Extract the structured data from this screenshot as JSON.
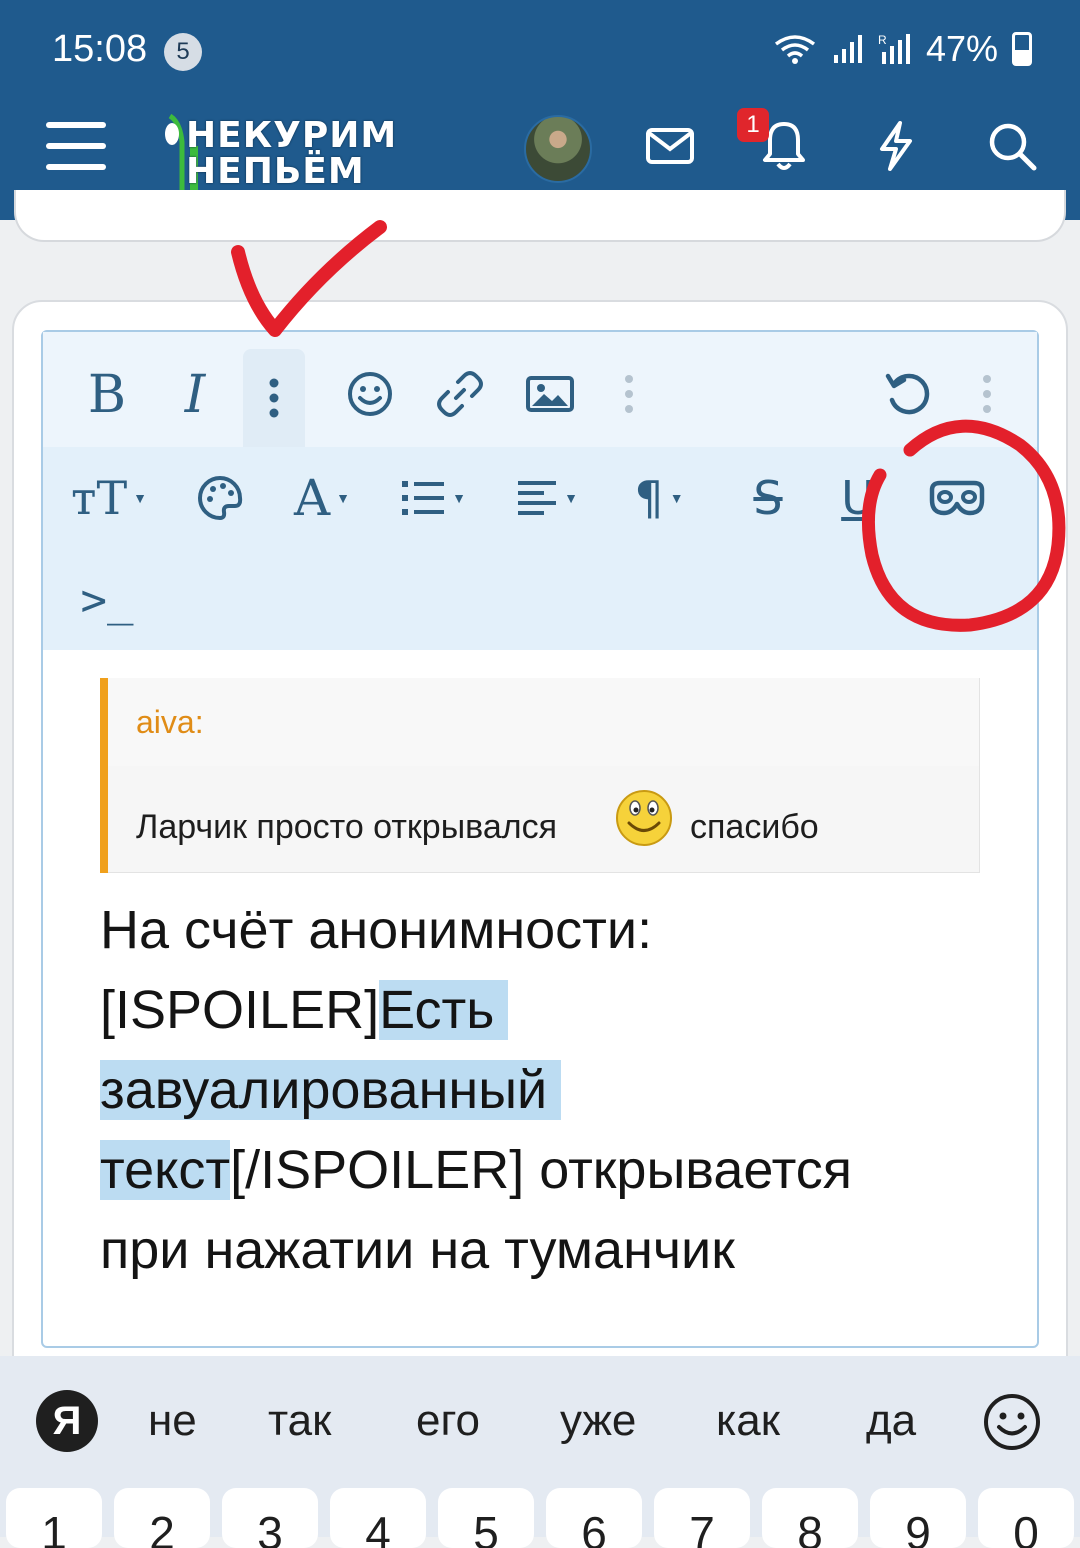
{
  "status_bar": {
    "time": "15:08",
    "notification_count": "5",
    "battery": "47%"
  },
  "header": {
    "logo_line1": "НЕКУРИМ",
    "logo_line2": "НЕПЬЁМ",
    "notification_badge": "1",
    "icons": [
      "menu-icon",
      "avatar",
      "mail-icon",
      "bell-icon",
      "lightning-icon",
      "search-icon"
    ]
  },
  "toolbar": {
    "row1": [
      {
        "name": "bold-button",
        "glyph": "B"
      },
      {
        "name": "italic-button",
        "glyph": "I"
      },
      {
        "name": "more-options-button",
        "glyph": "⋮"
      },
      {
        "name": "emoji-button",
        "glyph": "smiley-icon"
      },
      {
        "name": "link-button",
        "glyph": "link-icon"
      },
      {
        "name": "image-button",
        "glyph": "image-icon"
      },
      {
        "name": "more-insert-button",
        "glyph": "⋮"
      },
      {
        "name": "undo-button",
        "glyph": "undo-icon"
      },
      {
        "name": "more-menu-button",
        "glyph": "⋮"
      }
    ],
    "row2": [
      {
        "name": "font-size-button",
        "glyph": "тT"
      },
      {
        "name": "color-button",
        "glyph": "palette-icon"
      },
      {
        "name": "font-family-button",
        "glyph": "A"
      },
      {
        "name": "list-button",
        "glyph": "list-icon"
      },
      {
        "name": "align-button",
        "glyph": "align-icon"
      },
      {
        "name": "paragraph-button",
        "glyph": "¶"
      },
      {
        "name": "strikethrough-button",
        "glyph": "S"
      },
      {
        "name": "underline-button",
        "glyph": "U"
      },
      {
        "name": "spoiler-button",
        "glyph": "mask-icon"
      }
    ],
    "row3": [
      {
        "name": "code-button",
        "glyph": ">_"
      }
    ]
  },
  "quote": {
    "author": "aiva:",
    "text": "Ларчик просто открывался",
    "text_after": "спасибо"
  },
  "body": {
    "line1": "На счёт анонимности:",
    "line2_pre": "[ISPOILER]",
    "line2_hl": "Есть",
    "line3_hl": "завуалированный",
    "line4_hl": "текст",
    "line4_post": "[/ISPOILER] открывается",
    "line5": "при нажатии на туманчик"
  },
  "keyboard": {
    "logo": "Я",
    "suggestions": [
      "не",
      "так",
      "его",
      "уже",
      "как",
      "да"
    ],
    "number_row": [
      "1",
      "2",
      "3",
      "4",
      "5",
      "6",
      "7",
      "8",
      "9",
      "0"
    ]
  },
  "colors": {
    "header_bg": "#1f5a8d",
    "toolbar_bg": "#e3f0fa",
    "icon_color": "#2f5f82",
    "quote_accent": "#f0a01c",
    "highlight": "#bcdcf2",
    "annotation_red": "#e3202b"
  }
}
